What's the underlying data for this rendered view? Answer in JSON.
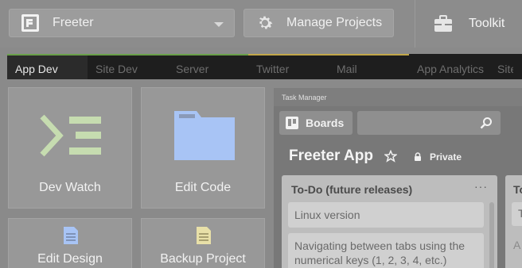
{
  "topbar": {
    "project_name": "Freeter",
    "manage_label": "Manage Projects",
    "toolkit_label": "Toolkit"
  },
  "tabs": [
    {
      "label": "App Dev",
      "active": true,
      "accent": "#6aa04a"
    },
    {
      "label": "Site Dev",
      "active": false,
      "accent": "#6aa04a"
    },
    {
      "label": "Server",
      "active": false,
      "accent": "#6aa04a"
    },
    {
      "label": "Twitter",
      "active": false,
      "accent": "#c2a84a"
    },
    {
      "label": "Mail",
      "active": false,
      "accent": "#c2a84a"
    },
    {
      "label": "App Analytics",
      "active": false,
      "accent": ""
    },
    {
      "label": "Site",
      "active": false,
      "accent": ""
    }
  ],
  "tiles": [
    {
      "label": "Dev Watch",
      "icon": "terminal-icon",
      "color": "#c6dcb0"
    },
    {
      "label": "Edit Code",
      "icon": "folder-icon",
      "color": "#a8c4f5"
    },
    {
      "label": "Edit Design",
      "icon": "document-icon",
      "color": "#a8c4f5"
    },
    {
      "label": "Backup Project",
      "icon": "document-icon",
      "color": "#e8e0a8"
    }
  ],
  "task_manager": {
    "window_title": "Task Manager",
    "boards_label": "Boards",
    "board_title": "Freeter App",
    "visibility_label": "Private",
    "lists": [
      {
        "title": "To-Do (future releases)",
        "menu": "···",
        "cards": [
          "Linux version",
          "Navigating between tabs using the numerical keys (1, 2, 3, 4, etc.)"
        ]
      },
      {
        "title": "To",
        "cards": [
          "T"
        ],
        "add_text": "A"
      }
    ]
  }
}
